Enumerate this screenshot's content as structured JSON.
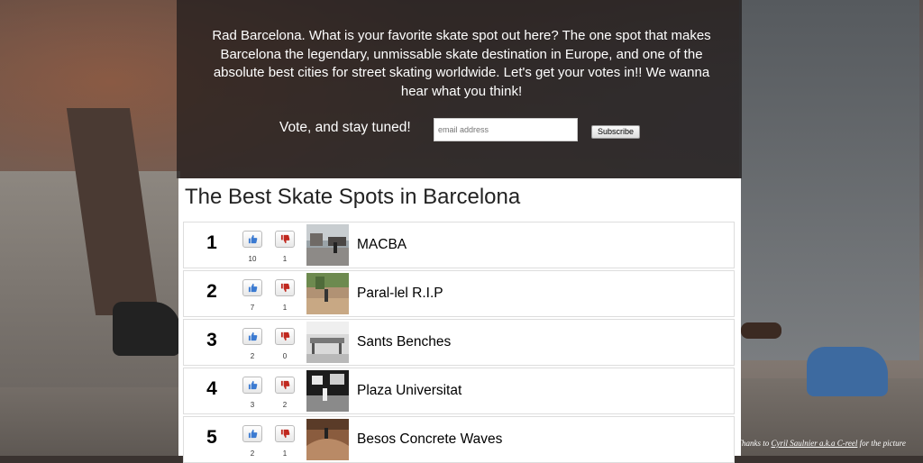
{
  "intro": {
    "text": "Rad Barcelona. What is your favorite skate spot out here? The one spot that makes Barcelona the legendary, unmissable skate destination in Europe, and one of the absolute best cities for street skating worldwide. Let's get your votes in!! We wanna hear what you think!"
  },
  "subscribe": {
    "prompt": "Vote, and stay tuned!",
    "email_placeholder": "email address",
    "button_label": "Subscribe"
  },
  "list": {
    "title": "The Best Skate Spots in Barcelona",
    "items": [
      {
        "rank": "1",
        "name": "MACBA",
        "up": "10",
        "down": "1"
      },
      {
        "rank": "2",
        "name": "Paral-lel R.I.P",
        "up": "7",
        "down": "1"
      },
      {
        "rank": "3",
        "name": "Sants Benches",
        "up": "2",
        "down": "0"
      },
      {
        "rank": "4",
        "name": "Plaza Universitat",
        "up": "3",
        "down": "2"
      },
      {
        "rank": "5",
        "name": "Besos Concrete Waves",
        "up": "2",
        "down": "1"
      }
    ]
  },
  "credit": {
    "prefix": "Thanks to ",
    "link": "Cyril Saulnier a.k.a C-reel",
    "suffix": " for the picture"
  },
  "colors": {
    "thumbs_up": "#3b7ad1",
    "thumbs_down": "#c0281e"
  }
}
